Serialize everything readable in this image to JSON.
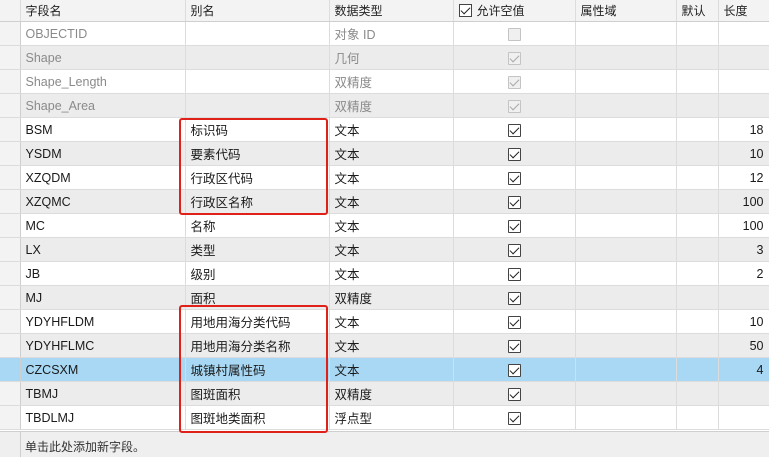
{
  "columns": {
    "field_name": "字段名",
    "alias": "别名",
    "data_type": "数据类型",
    "allow_null": "允许空值",
    "domain": "属性域",
    "default": "默认",
    "length": "长度"
  },
  "rows": [
    {
      "name": "OBJECTID",
      "alias": "",
      "type": "对象 ID",
      "allow_null": false,
      "length": ""
    },
    {
      "name": "Shape",
      "alias": "",
      "type": "几何",
      "allow_null": true,
      "length": ""
    },
    {
      "name": "Shape_Length",
      "alias": "",
      "type": "双精度",
      "allow_null": true,
      "length": ""
    },
    {
      "name": "Shape_Area",
      "alias": "",
      "type": "双精度",
      "allow_null": true,
      "length": ""
    },
    {
      "name": "BSM",
      "alias": "标识码",
      "type": "文本",
      "allow_null": true,
      "length": "18"
    },
    {
      "name": "YSDM",
      "alias": "要素代码",
      "type": "文本",
      "allow_null": true,
      "length": "10"
    },
    {
      "name": "XZQDM",
      "alias": "行政区代码",
      "type": "文本",
      "allow_null": true,
      "length": "12"
    },
    {
      "name": "XZQMC",
      "alias": "行政区名称",
      "type": "文本",
      "allow_null": true,
      "length": "100"
    },
    {
      "name": "MC",
      "alias": "名称",
      "type": "文本",
      "allow_null": true,
      "length": "100"
    },
    {
      "name": "LX",
      "alias": "类型",
      "type": "文本",
      "allow_null": true,
      "length": "3"
    },
    {
      "name": "JB",
      "alias": "级别",
      "type": "文本",
      "allow_null": true,
      "length": "2"
    },
    {
      "name": "MJ",
      "alias": "面积",
      "type": "双精度",
      "allow_null": true,
      "length": ""
    },
    {
      "name": "YDYHFLDM",
      "alias": "用地用海分类代码",
      "type": "文本",
      "allow_null": true,
      "length": "10"
    },
    {
      "name": "YDYHFLMC",
      "alias": "用地用海分类名称",
      "type": "文本",
      "allow_null": true,
      "length": "50"
    },
    {
      "name": "CZCSXM",
      "alias": "城镇村属性码",
      "type": "文本",
      "allow_null": true,
      "length": "4"
    },
    {
      "name": "TBMJ",
      "alias": "图斑面积",
      "type": "双精度",
      "allow_null": true,
      "length": ""
    },
    {
      "name": "TBDLMJ",
      "alias": "图斑地类面积",
      "type": "浮点型",
      "allow_null": true,
      "length": ""
    }
  ],
  "selected_row": "CZCSXM",
  "footer_text": "单击此处添加新字段。",
  "highlight_color": "#e0211a",
  "selected_color": "#a8d8f3"
}
